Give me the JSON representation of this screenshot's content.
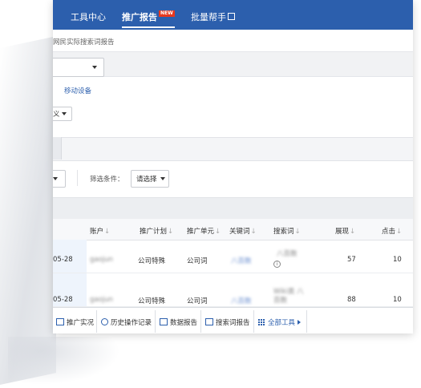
{
  "nav": {
    "tools": "工具中心",
    "report": "推广报告",
    "badge": "NEW",
    "batch": "批量帮手"
  },
  "description": "网民实际搜索词报告",
  "filters": {
    "mobile_device": "移动设备",
    "select_partial": "义",
    "condition_label": "筛选条件：",
    "condition_value": "请选择"
  },
  "table": {
    "headers": {
      "account": "账户",
      "plan": "推广计划",
      "unit": "推广单元",
      "keyword": "关键词",
      "search_term": "搜索词",
      "impressions": "展现",
      "clicks": "点击"
    },
    "rows": [
      {
        "date": "05-28",
        "account": "gaojun",
        "plan": "公司特殊",
        "unit": "公司词",
        "keyword": "八百数",
        "search_term": "八百数",
        "impressions": "57",
        "clicks": "10"
      },
      {
        "date": "05-28",
        "account": "gaojun",
        "plan": "公司特殊",
        "unit": "公司词",
        "keyword": "八百数",
        "search_term": "Wiki类 八百数",
        "impressions": "88",
        "clicks": "10"
      }
    ]
  },
  "toolbar": {
    "promo_status": "推广实况",
    "history": "历史操作记录",
    "data_report": "数据报告",
    "search_report": "搜索词报告",
    "all_tools": "全部工具"
  },
  "colors": {
    "brand_blue": "#2c5fad",
    "badge_red": "#e8381d"
  }
}
